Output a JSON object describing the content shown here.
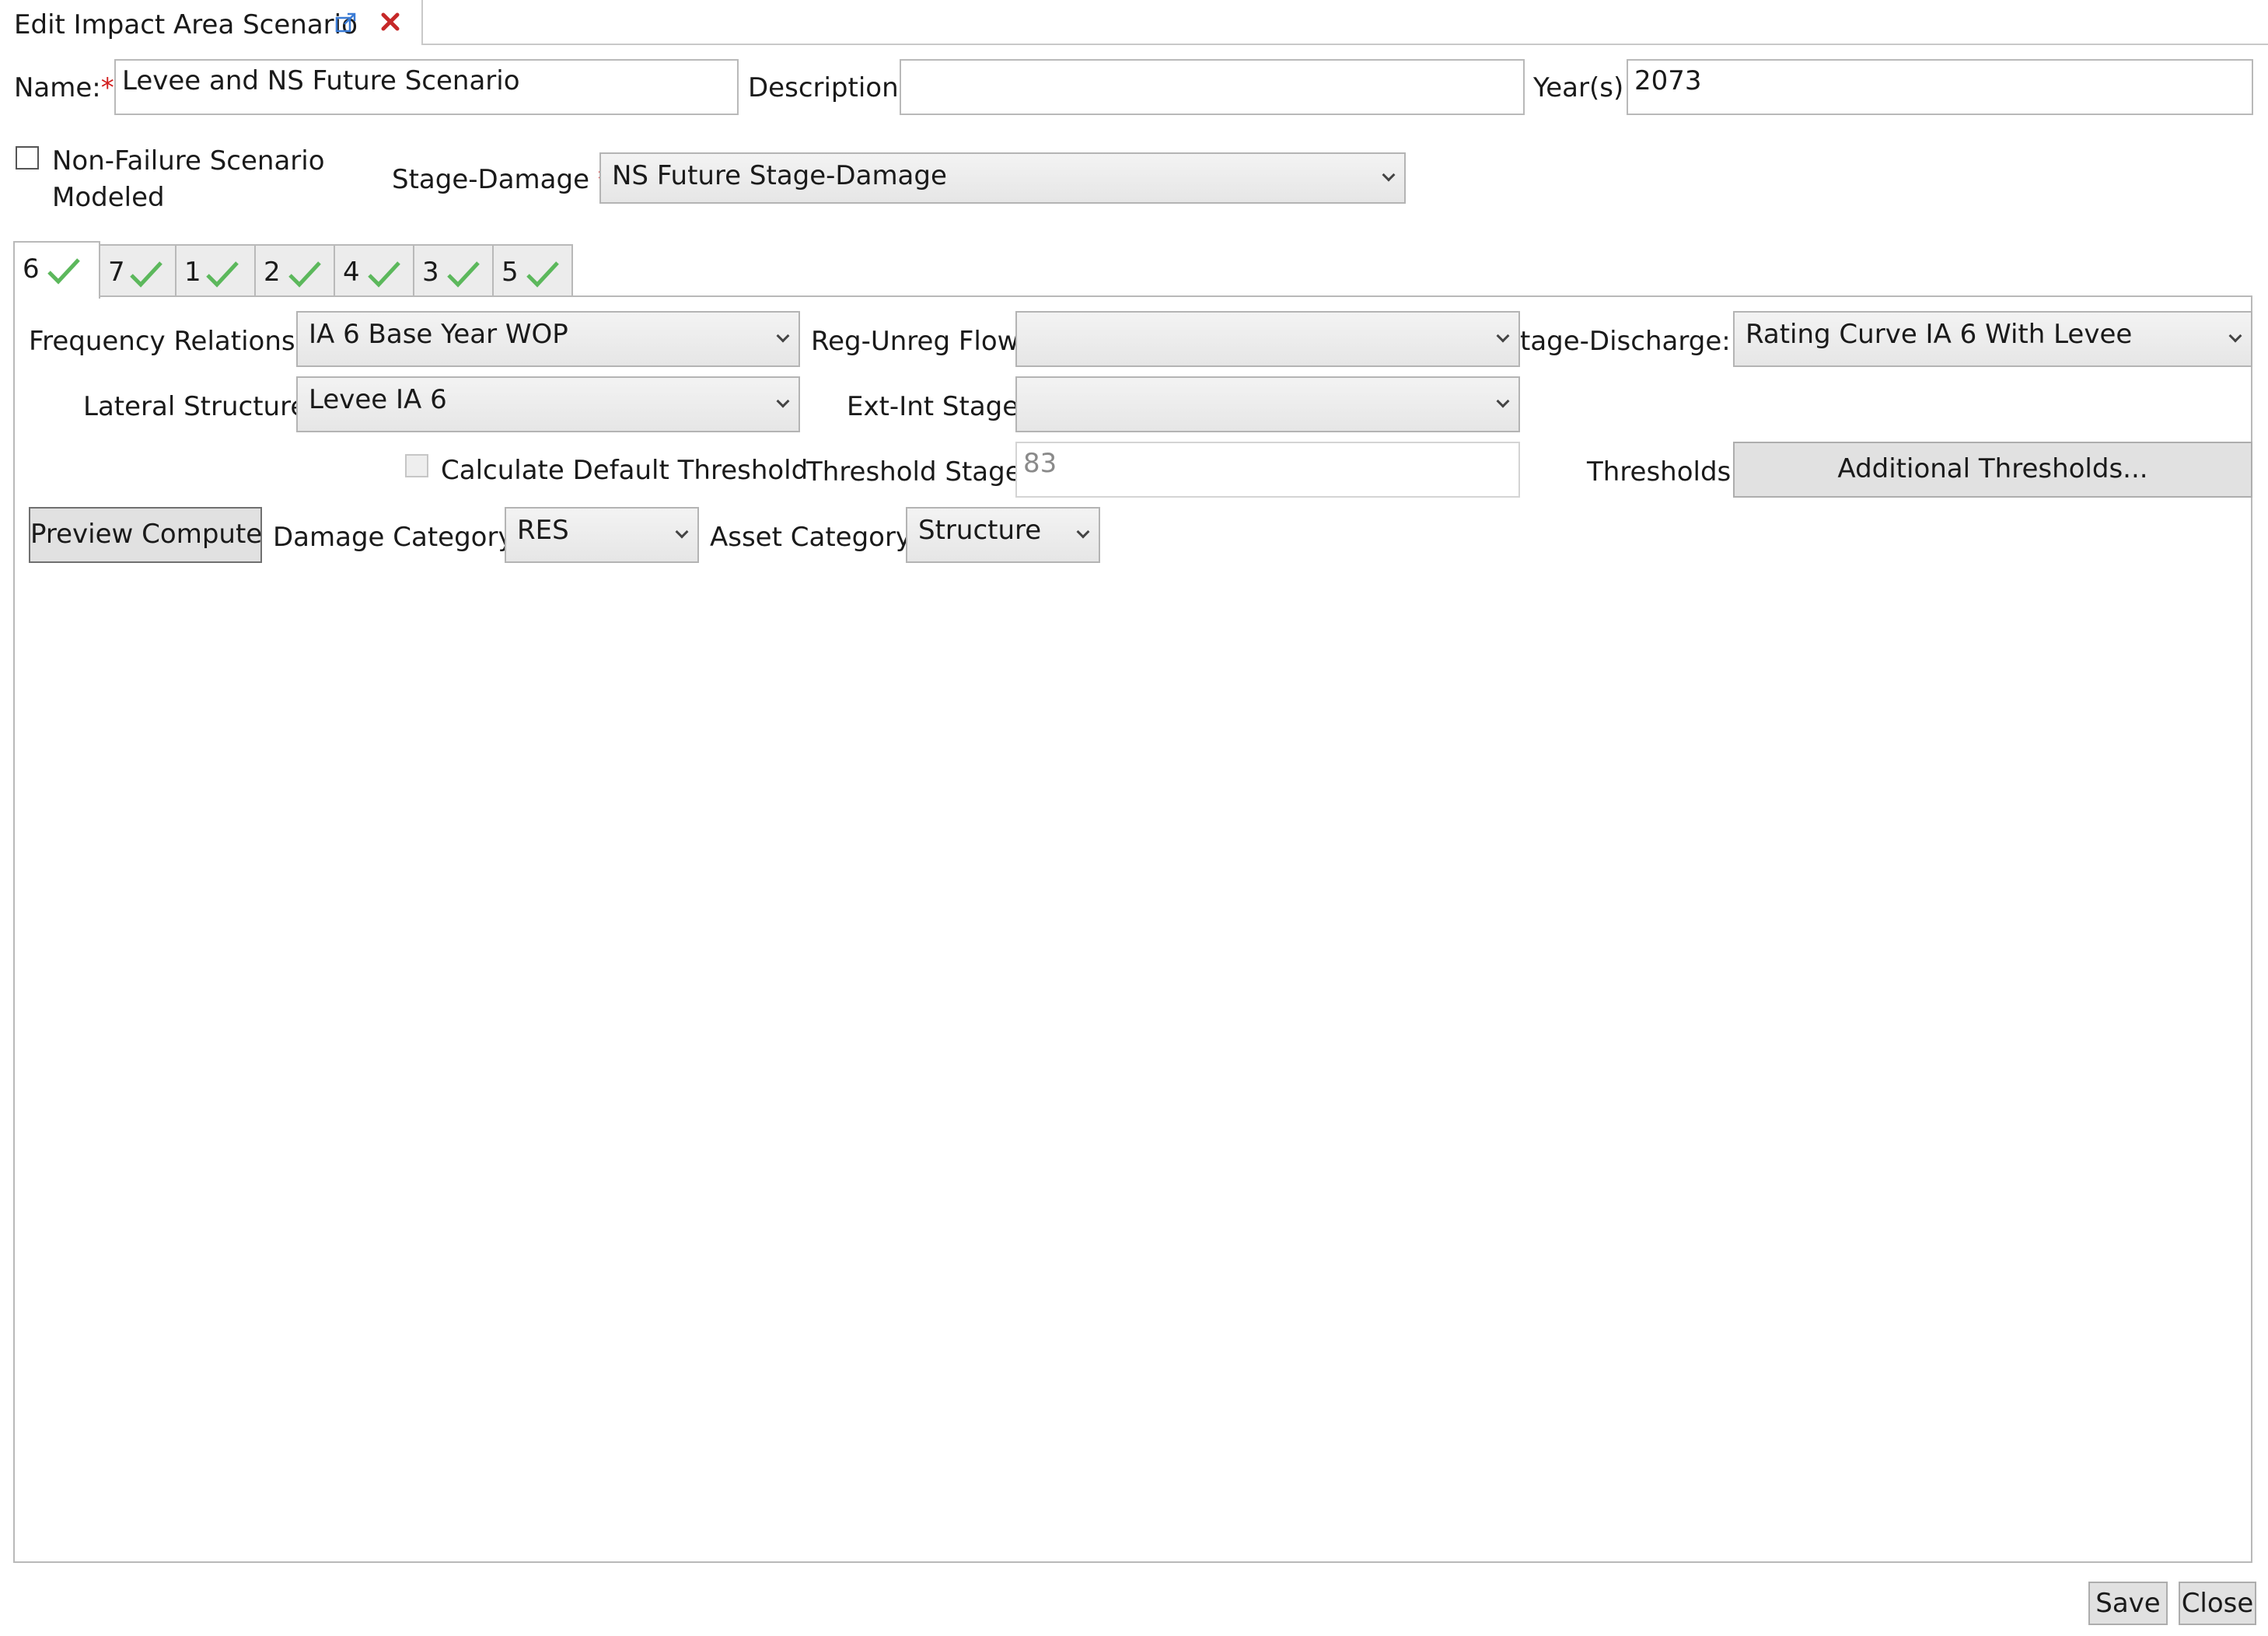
{
  "window": {
    "title": "Edit Impact Area Scenario",
    "popout_icon": "popout-icon",
    "close_icon": "close-x-icon",
    "close_icon_color": "#c62828"
  },
  "form": {
    "name_label": "Name:",
    "required_mark": "*",
    "name_value": "Levee and NS Future Scenario",
    "description_label": "Description:",
    "description_value": "",
    "years_label": "Year(s):",
    "years_value": "2073",
    "non_failure_label_line1": "Non-Failure Scenario",
    "non_failure_label_line2": "Modeled",
    "non_failure_checked": false,
    "stage_damage_label": "Stage-Damage",
    "stage_damage_value": "NS Future Stage-Damage"
  },
  "tabs": [
    {
      "label": "6",
      "selected": true
    },
    {
      "label": "7",
      "selected": false
    },
    {
      "label": "1",
      "selected": false
    },
    {
      "label": "2",
      "selected": false
    },
    {
      "label": "4",
      "selected": false
    },
    {
      "label": "3",
      "selected": false
    },
    {
      "label": "5",
      "selected": false
    }
  ],
  "tab_check_color": "#5cb85c",
  "panel": {
    "frequency_label": "Frequency Relations",
    "frequency_value": "IA 6 Base Year WOP",
    "reg_unreg_label": "Reg-Unreg Flow",
    "reg_unreg_value": "",
    "stage_discharge_label": "tage-Discharge:",
    "stage_discharge_value": "Rating Curve IA 6 With Levee",
    "lateral_label": "Lateral Structure:",
    "lateral_value": "Levee IA 6",
    "ext_int_label": "Ext-Int Stage:",
    "ext_int_value": "",
    "calc_default_label": "Calculate Default Threshold",
    "calc_default_checked": false,
    "threshold_stage_label": "Threshold Stage:",
    "threshold_stage_value": "83",
    "thresholds_label": "Thresholds:",
    "additional_thresholds_button": "Additional Thresholds...",
    "preview_compute_button": "Preview Compute",
    "damage_category_label": "Damage Category:",
    "damage_category_value": "RES",
    "asset_category_label": "Asset Category:",
    "asset_category_value": "Structure"
  },
  "footer": {
    "save_button": "Save",
    "close_button": "Close"
  }
}
